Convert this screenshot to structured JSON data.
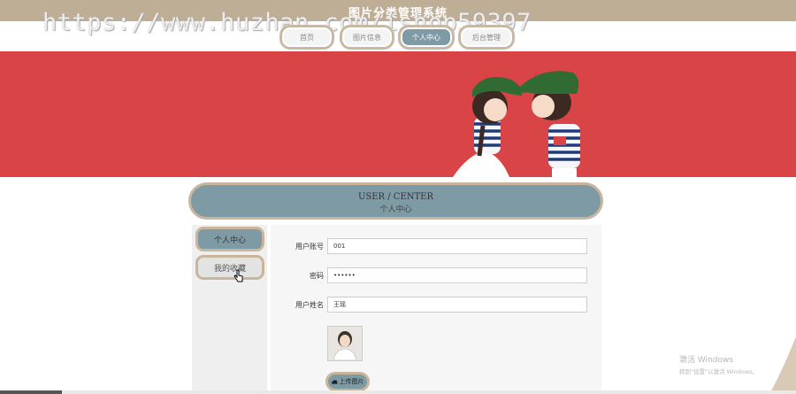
{
  "app": {
    "title": "图片分类管理系统"
  },
  "watermark": "https://www.huzhan.com/ishop59397",
  "nav": [
    {
      "label": "首页"
    },
    {
      "label": "图片信息"
    },
    {
      "label": "个人中心",
      "active": true
    },
    {
      "label": "后台管理"
    }
  ],
  "section": {
    "title_en": "USER / CENTER",
    "title_zh": "个人中心"
  },
  "sidebar": [
    {
      "label": "个人中心",
      "active": true
    },
    {
      "label": "我的收藏",
      "active": false
    }
  ],
  "form": {
    "fields": [
      {
        "label": "用户账号",
        "value": "001"
      },
      {
        "label": "密码",
        "value": "••••••"
      },
      {
        "label": "用户姓名",
        "value": "王瑶"
      }
    ],
    "upload_label": "上传图片"
  },
  "windows": {
    "line1": "激活 Windows",
    "line2": "转到\"设置\"以激活 Windows。"
  },
  "colors": {
    "topbar": "#bfae96",
    "accent": "#7e9ba5",
    "banner": "#d94547",
    "border": "#c9b59b"
  }
}
